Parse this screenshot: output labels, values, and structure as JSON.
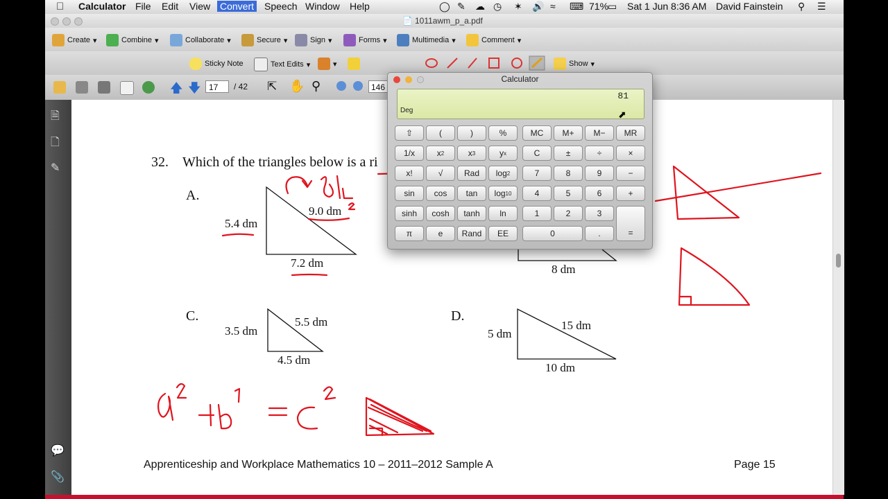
{
  "menubar": {
    "app": "Calculator",
    "items": [
      "File",
      "Edit",
      "View",
      "Convert",
      "Speech",
      "Window",
      "Help"
    ],
    "battery": "71%",
    "datetime": "Sat 1 Jun  8:36 AM",
    "user": "David Fainstein"
  },
  "window": {
    "title": "1011awm_p_a.pdf"
  },
  "toolbar1": [
    "Create",
    "Combine",
    "Collaborate",
    "Secure",
    "Sign",
    "Forms",
    "Multimedia",
    "Comment"
  ],
  "toolbar2": {
    "sticky": "Sticky Note",
    "textedits": "Text Edits",
    "show": "Show"
  },
  "toolbar3": {
    "page": "17",
    "total": "/ 42",
    "zoom": "146"
  },
  "document": {
    "question_number": "32.",
    "question_text": "Which of the triangles below is a ri",
    "a": {
      "label": "A.",
      "side1": "5.4 dm",
      "side2": "9.0 dm",
      "side3": "7.2 dm"
    },
    "b": {
      "side": "8 dm"
    },
    "c": {
      "label": "C.",
      "side1": "3.5 dm",
      "side2": "5.5 dm",
      "side3": "4.5 dm"
    },
    "d": {
      "label": "D.",
      "side1": "5 dm",
      "side2": "15 dm",
      "side3": "10 dm"
    },
    "footer_left": "Apprenticeship and Workplace Mathematics 10 – 2011–2012 Sample A",
    "footer_right": "Page 15",
    "annotation_color": "#e0141e"
  },
  "calculator": {
    "title": "Calculator",
    "display": "81",
    "mode": "Deg",
    "lcd_color": "#e3eeb8"
  }
}
